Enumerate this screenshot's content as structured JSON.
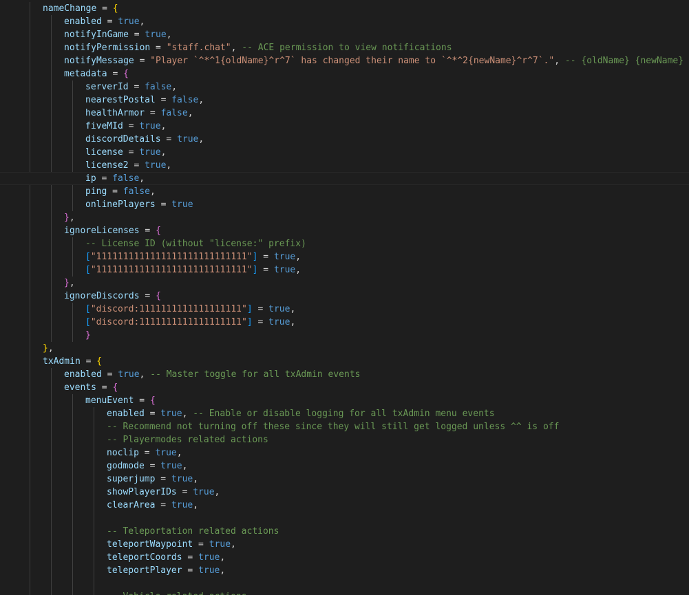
{
  "colors": {
    "background": "#1e1e1e",
    "variable": "#9cdcfe",
    "operator": "#d4d4d4",
    "boolean": "#569cd6",
    "string": "#ce9178",
    "comment": "#6a9955",
    "bracket_level_1": "#ffd700",
    "bracket_level_2": "#da70d6",
    "bracket_level_3": "#179fff"
  },
  "lines": [
    {
      "indent": 1,
      "tokens": [
        [
          "var",
          "nameChange"
        ],
        [
          "op",
          " = "
        ],
        [
          "b1",
          "{"
        ]
      ]
    },
    {
      "indent": 2,
      "tokens": [
        [
          "var",
          "enabled"
        ],
        [
          "op",
          " = "
        ],
        [
          "bool",
          "true"
        ],
        [
          "op",
          ","
        ]
      ]
    },
    {
      "indent": 2,
      "tokens": [
        [
          "var",
          "notifyInGame"
        ],
        [
          "op",
          " = "
        ],
        [
          "bool",
          "true"
        ],
        [
          "op",
          ","
        ]
      ]
    },
    {
      "indent": 2,
      "tokens": [
        [
          "var",
          "notifyPermission"
        ],
        [
          "op",
          " = "
        ],
        [
          "str",
          "\"staff.chat\""
        ],
        [
          "op",
          ", "
        ],
        [
          "cmt",
          "-- ACE permission to view notifications"
        ]
      ]
    },
    {
      "indent": 2,
      "tokens": [
        [
          "var",
          "notifyMessage"
        ],
        [
          "op",
          " = "
        ],
        [
          "str",
          "\"Player `^*^1{oldName}^r^7` has changed their name to `^*^2{newName}^r^7`.\""
        ],
        [
          "op",
          ", "
        ],
        [
          "cmt",
          "-- {oldName} {newName}"
        ]
      ]
    },
    {
      "indent": 2,
      "tokens": [
        [
          "var",
          "metadata"
        ],
        [
          "op",
          " = "
        ],
        [
          "b2",
          "{"
        ]
      ]
    },
    {
      "indent": 3,
      "tokens": [
        [
          "var",
          "serverId"
        ],
        [
          "op",
          " = "
        ],
        [
          "bool",
          "false"
        ],
        [
          "op",
          ","
        ]
      ]
    },
    {
      "indent": 3,
      "tokens": [
        [
          "var",
          "nearestPostal"
        ],
        [
          "op",
          " = "
        ],
        [
          "bool",
          "false"
        ],
        [
          "op",
          ","
        ]
      ]
    },
    {
      "indent": 3,
      "tokens": [
        [
          "var",
          "healthArmor"
        ],
        [
          "op",
          " = "
        ],
        [
          "bool",
          "false"
        ],
        [
          "op",
          ","
        ]
      ]
    },
    {
      "indent": 3,
      "tokens": [
        [
          "var",
          "fiveMId"
        ],
        [
          "op",
          " = "
        ],
        [
          "bool",
          "true"
        ],
        [
          "op",
          ","
        ]
      ]
    },
    {
      "indent": 3,
      "tokens": [
        [
          "var",
          "discordDetails"
        ],
        [
          "op",
          " = "
        ],
        [
          "bool",
          "true"
        ],
        [
          "op",
          ","
        ]
      ]
    },
    {
      "indent": 3,
      "tokens": [
        [
          "var",
          "license"
        ],
        [
          "op",
          " = "
        ],
        [
          "bool",
          "true"
        ],
        [
          "op",
          ","
        ]
      ]
    },
    {
      "indent": 3,
      "tokens": [
        [
          "var",
          "license2"
        ],
        [
          "op",
          " = "
        ],
        [
          "bool",
          "true"
        ],
        [
          "op",
          ","
        ]
      ]
    },
    {
      "indent": 3,
      "tokens": [
        [
          "var",
          "ip"
        ],
        [
          "op",
          " = "
        ],
        [
          "bool",
          "false"
        ],
        [
          "op",
          ","
        ]
      ]
    },
    {
      "indent": 3,
      "tokens": [
        [
          "var",
          "ping"
        ],
        [
          "op",
          " = "
        ],
        [
          "bool",
          "false"
        ],
        [
          "op",
          ","
        ]
      ]
    },
    {
      "indent": 3,
      "tokens": [
        [
          "var",
          "onlinePlayers"
        ],
        [
          "op",
          " = "
        ],
        [
          "bool",
          "true"
        ]
      ]
    },
    {
      "indent": 2,
      "tokens": [
        [
          "b2",
          "}"
        ],
        [
          "op",
          ","
        ]
      ]
    },
    {
      "indent": 2,
      "tokens": [
        [
          "var",
          "ignoreLicenses"
        ],
        [
          "op",
          " = "
        ],
        [
          "b2",
          "{"
        ]
      ]
    },
    {
      "indent": 3,
      "tokens": [
        [
          "cmt",
          "-- License ID (without \"license:\" prefix)"
        ]
      ]
    },
    {
      "indent": 3,
      "tokens": [
        [
          "b3",
          "["
        ],
        [
          "str",
          "\"1111111111111111111111111111\""
        ],
        [
          "b3",
          "]"
        ],
        [
          "op",
          " = "
        ],
        [
          "bool",
          "true"
        ],
        [
          "op",
          ","
        ]
      ]
    },
    {
      "indent": 3,
      "tokens": [
        [
          "b3",
          "["
        ],
        [
          "str",
          "\"1111111111111111111111111111\""
        ],
        [
          "b3",
          "]"
        ],
        [
          "op",
          " = "
        ],
        [
          "bool",
          "true"
        ],
        [
          "op",
          ","
        ]
      ]
    },
    {
      "indent": 2,
      "tokens": [
        [
          "b2",
          "}"
        ],
        [
          "op",
          ","
        ]
      ]
    },
    {
      "indent": 2,
      "tokens": [
        [
          "var",
          "ignoreDiscords"
        ],
        [
          "op",
          " = "
        ],
        [
          "b2",
          "{"
        ]
      ]
    },
    {
      "indent": 3,
      "tokens": [
        [
          "b3",
          "["
        ],
        [
          "str",
          "\"discord:1111111111111111111\""
        ],
        [
          "b3",
          "]"
        ],
        [
          "op",
          " = "
        ],
        [
          "bool",
          "true"
        ],
        [
          "op",
          ","
        ]
      ]
    },
    {
      "indent": 3,
      "tokens": [
        [
          "b3",
          "["
        ],
        [
          "str",
          "\"discord:1111111111111111111\""
        ],
        [
          "b3",
          "]"
        ],
        [
          "op",
          " = "
        ],
        [
          "bool",
          "true"
        ],
        [
          "op",
          ","
        ]
      ]
    },
    {
      "indent": 3,
      "tokens": [
        [
          "b2",
          "}"
        ]
      ]
    },
    {
      "indent": 1,
      "tokens": [
        [
          "b1",
          "}"
        ],
        [
          "op",
          ","
        ]
      ]
    },
    {
      "indent": 1,
      "tokens": [
        [
          "var",
          "txAdmin"
        ],
        [
          "op",
          " = "
        ],
        [
          "b1",
          "{"
        ]
      ]
    },
    {
      "indent": 2,
      "tokens": [
        [
          "var",
          "enabled"
        ],
        [
          "op",
          " = "
        ],
        [
          "bool",
          "true"
        ],
        [
          "op",
          ", "
        ],
        [
          "cmt",
          "-- Master toggle for all txAdmin events"
        ]
      ]
    },
    {
      "indent": 2,
      "tokens": [
        [
          "var",
          "events"
        ],
        [
          "op",
          " = "
        ],
        [
          "b2",
          "{"
        ]
      ]
    },
    {
      "indent": 3,
      "tokens": [
        [
          "var",
          "menuEvent"
        ],
        [
          "op",
          " = "
        ],
        [
          "b3b",
          "{"
        ]
      ]
    },
    {
      "indent": 4,
      "tokens": [
        [
          "var",
          "enabled"
        ],
        [
          "op",
          " = "
        ],
        [
          "bool",
          "true"
        ],
        [
          "op",
          ", "
        ],
        [
          "cmt",
          "-- Enable or disable logging for all txAdmin menu events"
        ]
      ]
    },
    {
      "indent": 4,
      "tokens": [
        [
          "cmt",
          "-- Recommend not turning off these since they will still get logged unless ^^ is off"
        ]
      ]
    },
    {
      "indent": 4,
      "tokens": [
        [
          "cmt",
          "-- Playermodes related actions"
        ]
      ]
    },
    {
      "indent": 4,
      "tokens": [
        [
          "var",
          "noclip"
        ],
        [
          "op",
          " = "
        ],
        [
          "bool",
          "true"
        ],
        [
          "op",
          ","
        ]
      ]
    },
    {
      "indent": 4,
      "tokens": [
        [
          "var",
          "godmode"
        ],
        [
          "op",
          " = "
        ],
        [
          "bool",
          "true"
        ],
        [
          "op",
          ","
        ]
      ]
    },
    {
      "indent": 4,
      "tokens": [
        [
          "var",
          "superjump"
        ],
        [
          "op",
          " = "
        ],
        [
          "bool",
          "true"
        ],
        [
          "op",
          ","
        ]
      ]
    },
    {
      "indent": 4,
      "tokens": [
        [
          "var",
          "showPlayerIDs"
        ],
        [
          "op",
          " = "
        ],
        [
          "bool",
          "true"
        ],
        [
          "op",
          ","
        ]
      ]
    },
    {
      "indent": 4,
      "tokens": [
        [
          "var",
          "clearArea"
        ],
        [
          "op",
          " = "
        ],
        [
          "bool",
          "true"
        ],
        [
          "op",
          ","
        ]
      ]
    },
    {
      "indent": 4,
      "tokens": []
    },
    {
      "indent": 4,
      "tokens": [
        [
          "cmt",
          "-- Teleportation related actions"
        ]
      ]
    },
    {
      "indent": 4,
      "tokens": [
        [
          "var",
          "teleportWaypoint"
        ],
        [
          "op",
          " = "
        ],
        [
          "bool",
          "true"
        ],
        [
          "op",
          ","
        ]
      ]
    },
    {
      "indent": 4,
      "tokens": [
        [
          "var",
          "teleportCoords"
        ],
        [
          "op",
          " = "
        ],
        [
          "bool",
          "true"
        ],
        [
          "op",
          ","
        ]
      ]
    },
    {
      "indent": 4,
      "tokens": [
        [
          "var",
          "teleportPlayer"
        ],
        [
          "op",
          " = "
        ],
        [
          "bool",
          "true"
        ],
        [
          "op",
          ","
        ]
      ]
    },
    {
      "indent": 4,
      "tokens": []
    },
    {
      "indent": 4,
      "tokens": [
        [
          "cmt",
          "-- Vehicle related actions"
        ]
      ]
    }
  ]
}
